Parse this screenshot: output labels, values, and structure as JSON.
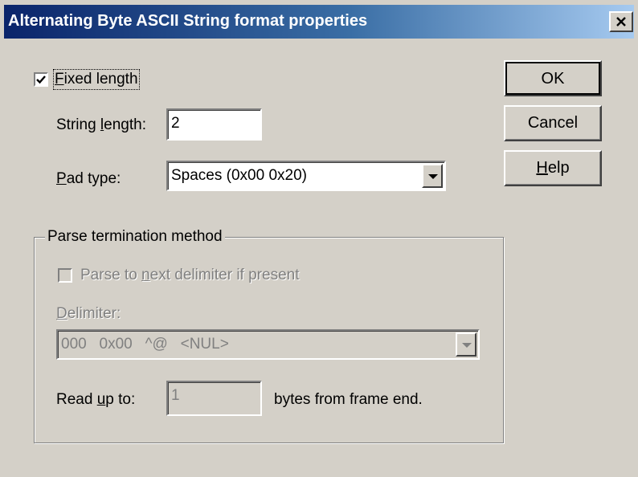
{
  "window": {
    "title": "Alternating Byte ASCII String format properties",
    "close_icon": "close-icon"
  },
  "fixed_length": {
    "label": "Fixed length",
    "checked": true
  },
  "string_length": {
    "label": "String length:",
    "value": "2"
  },
  "pad_type": {
    "label": "Pad type:",
    "selected": "Spaces (0x00 0x20)"
  },
  "parse_termination": {
    "group_title": "Parse termination method",
    "next_delimiter": {
      "label": "Parse to next delimiter if present",
      "checked": false,
      "enabled": false
    },
    "delimiter": {
      "label": "Delimiter:",
      "selected": "000   0x00   ^@   <NUL>",
      "enabled": false
    },
    "read_up_to": {
      "label": "Read up to:",
      "value": "1",
      "suffix": "bytes from frame end.",
      "enabled": false
    }
  },
  "buttons": {
    "ok": "OK",
    "cancel": "Cancel",
    "help": "Help"
  }
}
